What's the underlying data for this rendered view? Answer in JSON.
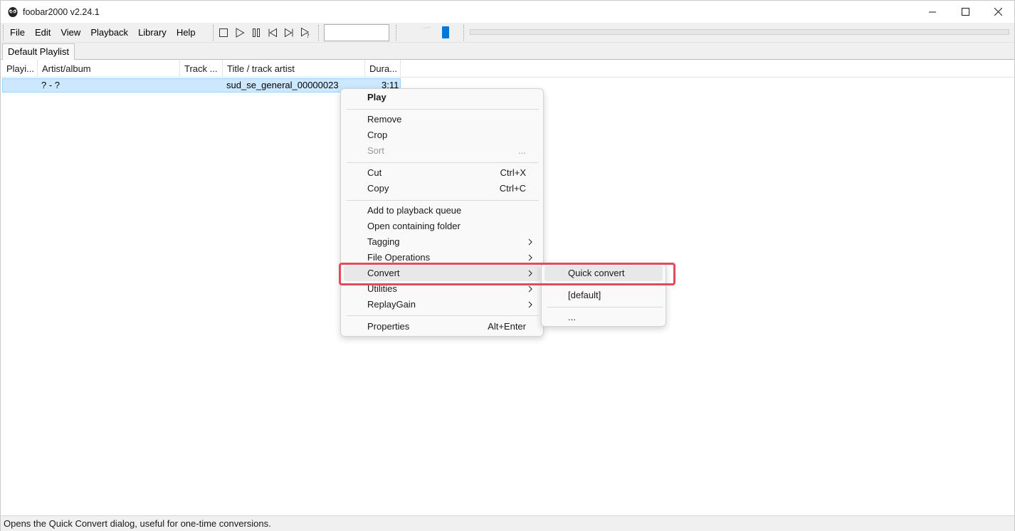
{
  "window": {
    "title": "foobar2000 v2.24.1"
  },
  "menubar": [
    "File",
    "Edit",
    "View",
    "Playback",
    "Library",
    "Help"
  ],
  "toolbar": {
    "buttons": [
      "stop-icon",
      "play-icon",
      "pause-icon",
      "previous-icon",
      "next-icon",
      "random-icon"
    ],
    "volume_level": 0.92
  },
  "tabs": [
    "Default Playlist"
  ],
  "playlist": {
    "columns": [
      "Playi...",
      "Artist/album",
      "Track ...",
      "Title / track artist",
      "Dura..."
    ],
    "rows": [
      {
        "playing": "",
        "artist_album": "? - ?",
        "track": "",
        "title": "sud_se_general_00000023",
        "duration": "3:11"
      }
    ]
  },
  "context_menu": {
    "play": "Play",
    "remove": "Remove",
    "crop": "Crop",
    "sort": "Sort",
    "sort_more": "...",
    "cut": "Cut",
    "cut_shortcut": "Ctrl+X",
    "copy": "Copy",
    "copy_shortcut": "Ctrl+C",
    "add_queue": "Add to playback queue",
    "open_folder": "Open containing folder",
    "tagging": "Tagging",
    "file_ops": "File Operations",
    "convert": "Convert",
    "utilities": "Utilities",
    "replaygain": "ReplayGain",
    "properties": "Properties",
    "properties_shortcut": "Alt+Enter"
  },
  "convert_submenu": {
    "quick_convert": "Quick convert",
    "default": "[default]",
    "more": "..."
  },
  "statusbar": {
    "text": "Opens the Quick Convert dialog, useful for one-time conversions."
  },
  "colors": {
    "selection": "#cce8ff",
    "highlight_box": "#e44b5a",
    "volume_thumb": "#0078d7"
  }
}
